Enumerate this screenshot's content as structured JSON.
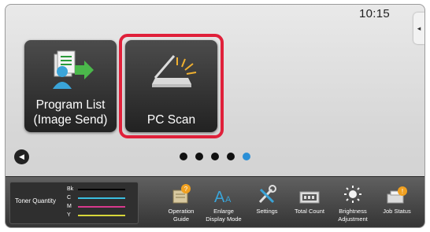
{
  "status": {
    "time": "10:15",
    "side_tab": "◂"
  },
  "tiles": [
    {
      "label_line1": "Program List",
      "label_line2": "(Image Send)",
      "selected": false
    },
    {
      "label_line1": "PC Scan",
      "label_line2": "",
      "selected": true
    }
  ],
  "pager": {
    "back_symbol": "◀",
    "pages": 5,
    "active_page": 5
  },
  "toner": {
    "title": "Toner Quantity",
    "colors": [
      {
        "name": "Bk",
        "color": "#000000"
      },
      {
        "name": "C",
        "color": "#3bbfe0"
      },
      {
        "name": "M",
        "color": "#d8398c"
      },
      {
        "name": "Y",
        "color": "#d8d63a"
      }
    ]
  },
  "function_bar": [
    {
      "line1": "Operation",
      "line2": "Guide",
      "icon": "operation-guide-icon"
    },
    {
      "line1": "Enlarge",
      "line2": "Display Mode",
      "icon": "enlarge-display-icon"
    },
    {
      "line1": "Settings",
      "line2": "",
      "icon": "settings-icon"
    },
    {
      "line1": "Total Count",
      "line2": "",
      "icon": "total-count-icon"
    },
    {
      "line1": "Brightness",
      "line2": "Adjustment",
      "icon": "brightness-icon"
    },
    {
      "line1": "Job Status",
      "line2": "",
      "icon": "job-status-icon"
    }
  ],
  "colors": {
    "highlight": "#e0203a",
    "active_dot": "#2b8fd6",
    "tile_bg": "#2e2e2e"
  }
}
